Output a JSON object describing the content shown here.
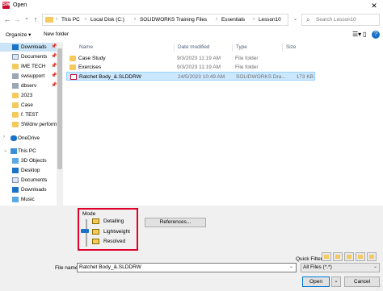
{
  "window": {
    "title": "Open",
    "app_icon": "SW",
    "close_glyph": "✕"
  },
  "nav": {
    "back_glyph": "←",
    "forward_glyph": "→",
    "recent_glyph": "⌄",
    "up_glyph": "↑",
    "breadcrumbs": [
      "This PC",
      "Local Disk (C:)",
      "SOLIDWORKS Training Files",
      "Essentials",
      "Lesson10"
    ],
    "separator": "›",
    "search_placeholder": "Search Lesson10"
  },
  "toolbar": {
    "organize": "Organize ▾",
    "new_folder": "New folder",
    "view_glyph": "☰▾",
    "pane_glyph": "▯",
    "help_glyph": "?"
  },
  "navpane": {
    "items": [
      {
        "label": "Downloads",
        "icon": "download-icon",
        "pinned": true,
        "selected": true
      },
      {
        "label": "Documents",
        "icon": "document-icon",
        "pinned": true
      },
      {
        "label": "IME TECH",
        "icon": "folder-icon",
        "pinned": true
      },
      {
        "label": "swsupport",
        "icon": "network-icon",
        "pinned": true
      },
      {
        "label": "dbserv",
        "icon": "network-icon",
        "pinned": true
      },
      {
        "label": "2023",
        "icon": "folder-icon"
      },
      {
        "label": "Case",
        "icon": "folder-icon"
      },
      {
        "label": "f. TEST",
        "icon": "folder-icon"
      },
      {
        "label": "SWdrw performa",
        "icon": "folder-icon"
      },
      {
        "label": "OneDrive",
        "icon": "cloud-icon",
        "chevron": true
      },
      {
        "label": "This PC",
        "icon": "pc-icon",
        "chevron": true
      },
      {
        "label": "3D Objects",
        "icon": "cube-icon"
      },
      {
        "label": "Desktop",
        "icon": "desktop-icon"
      },
      {
        "label": "Documents",
        "icon": "document-icon"
      },
      {
        "label": "Downloads",
        "icon": "download-icon"
      },
      {
        "label": "Music",
        "icon": "music-icon"
      }
    ]
  },
  "filelist": {
    "columns": [
      "Name",
      "Date modified",
      "Type",
      "Size"
    ],
    "rows": [
      {
        "name": "Case Study",
        "date": "9/3/2023 11:19 AM",
        "type": "File folder",
        "size": ""
      },
      {
        "name": "Exercises",
        "date": "9/3/2023 11:19 AM",
        "type": "File folder",
        "size": ""
      },
      {
        "name": "Ratchet Body_&.SLDDRW",
        "date": "24/5/2023 10:49 AM",
        "type": "SOLIDWORKS Dra...",
        "size": "173 KB",
        "selected": true
      }
    ]
  },
  "mode": {
    "label": "Mode",
    "options": [
      "Detailing",
      "Lightweight",
      "Resolved"
    ],
    "highlight_color": "#e0002a"
  },
  "references_button": "References...",
  "quick_filter_label": "Quick Filter:",
  "file_name_label": "File name:",
  "file_name_value": "Ratchet Body_&.SLDDRW",
  "file_type_filter": "All Files (*.*)",
  "open_button": "Open",
  "cancel_button": "Cancel",
  "dropdown_glyph": "⌄"
}
